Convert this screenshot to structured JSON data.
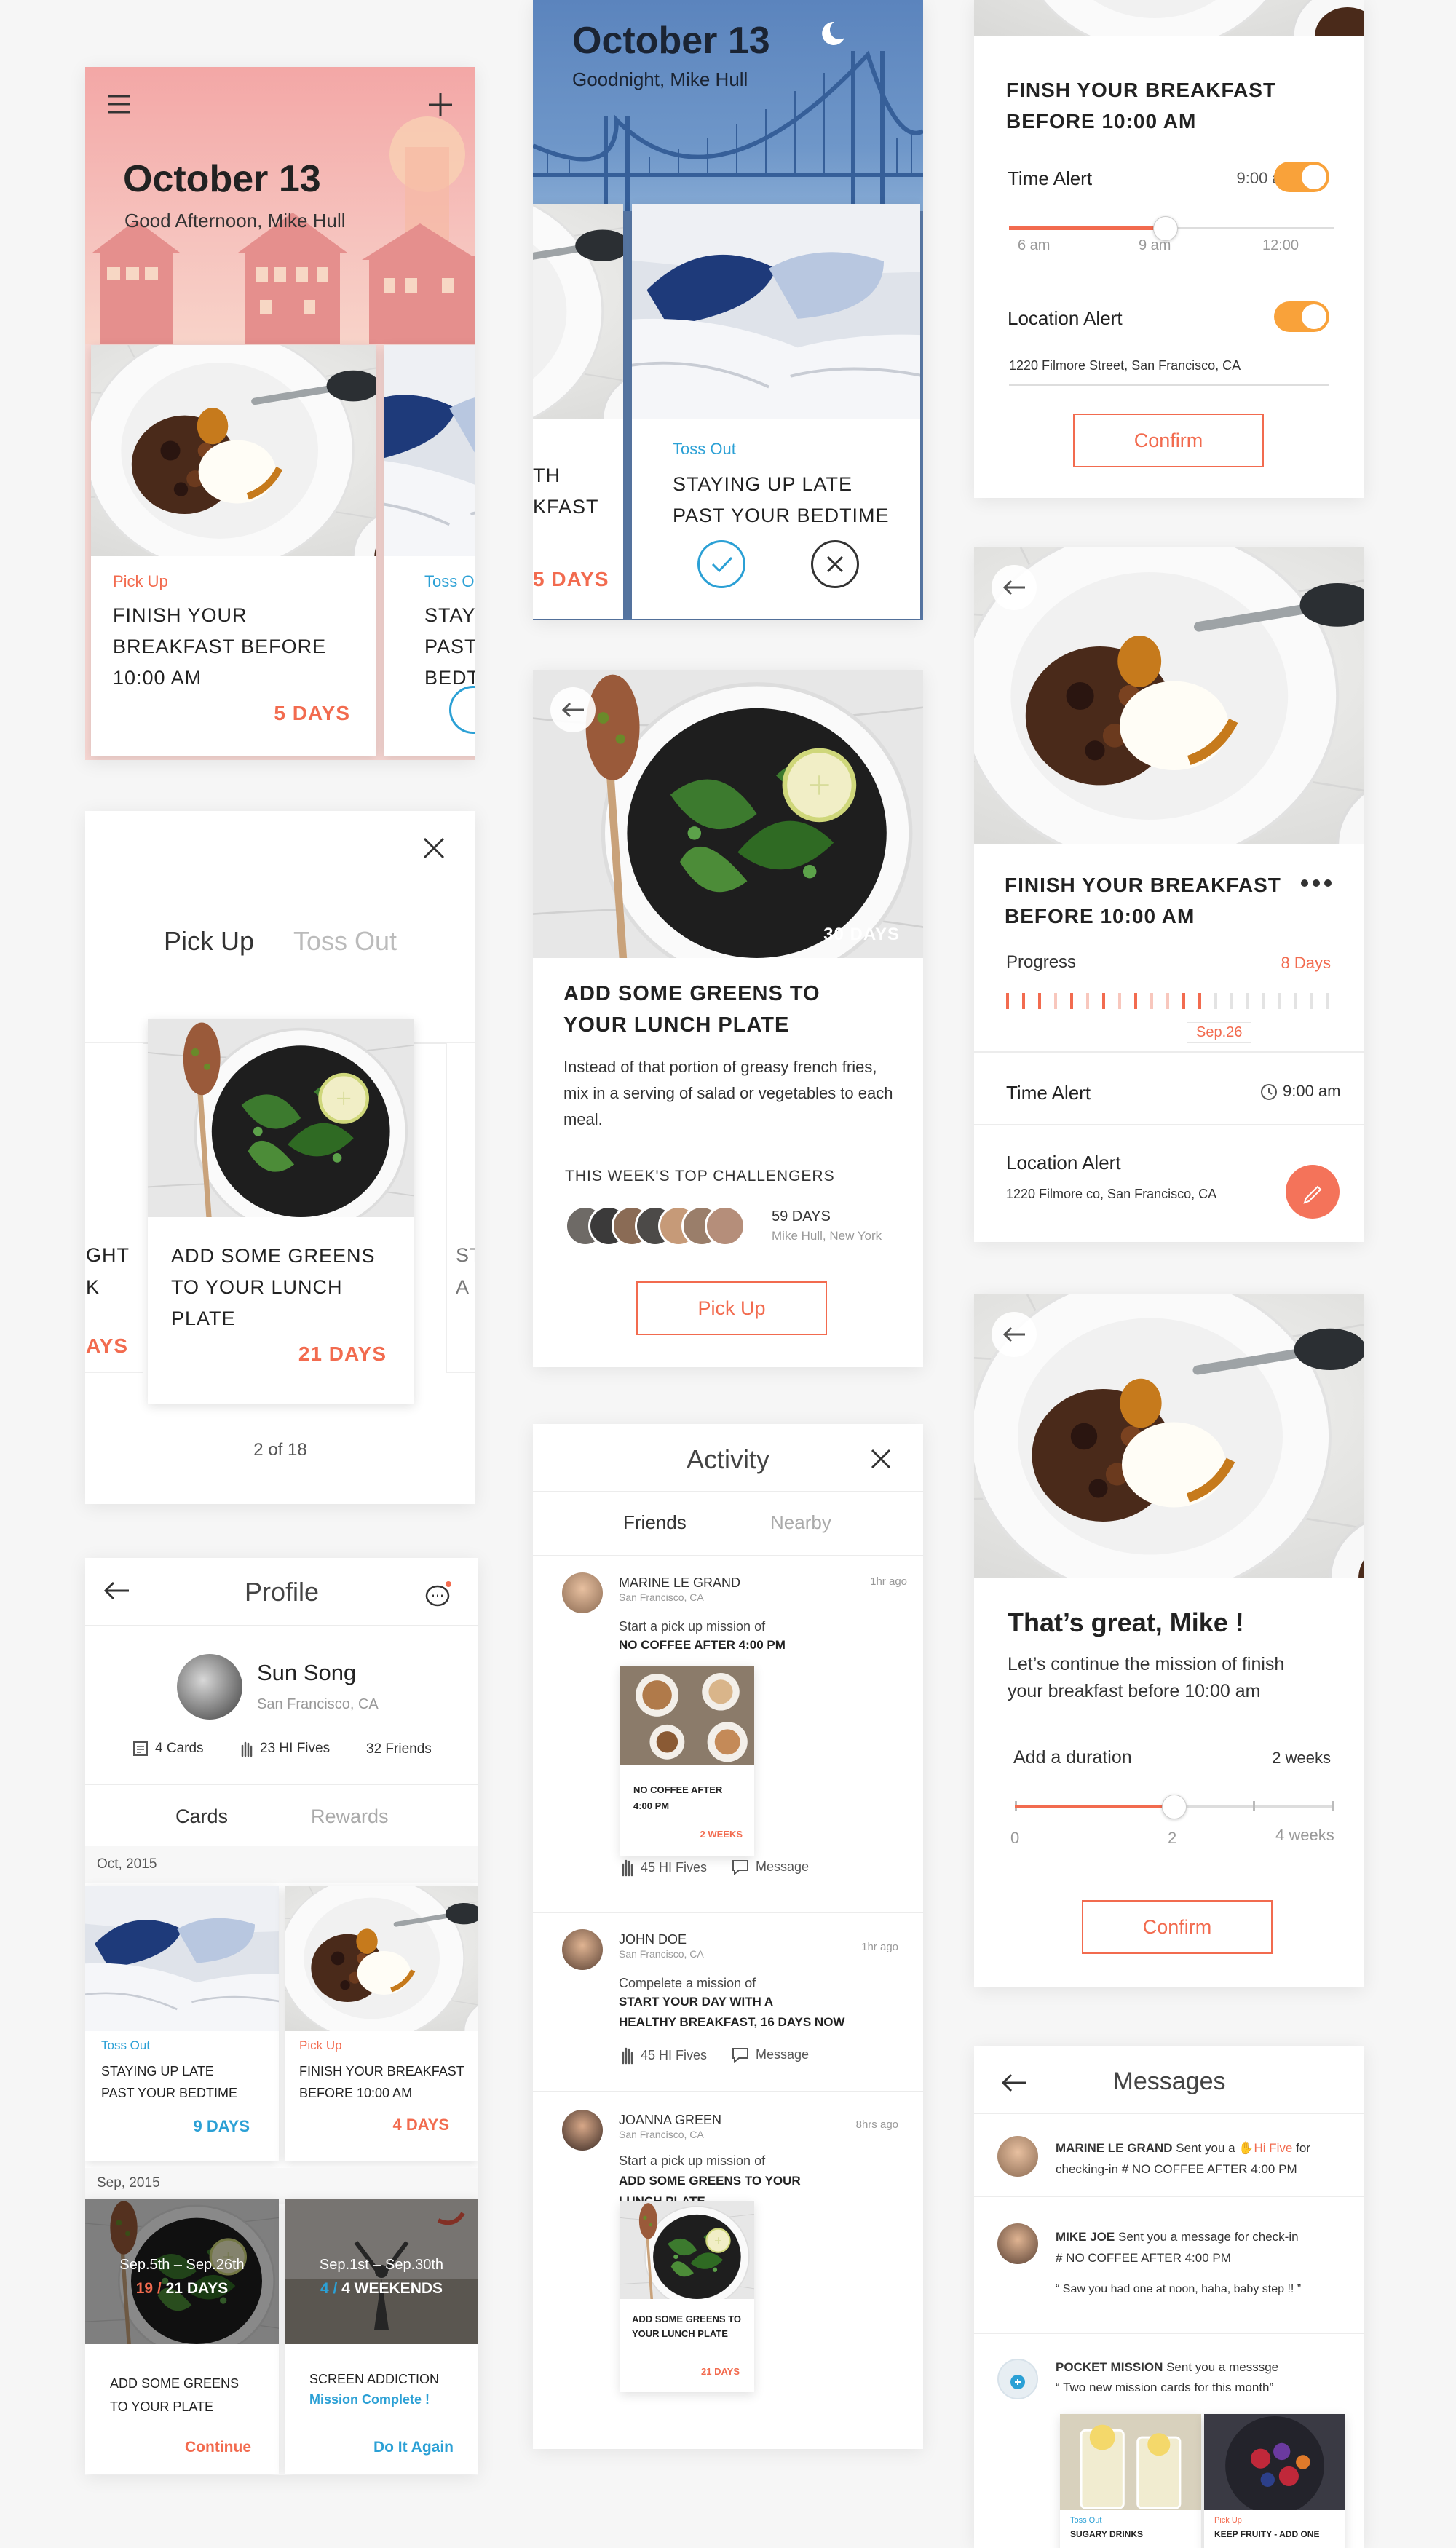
{
  "home_day": {
    "date": "October 13",
    "greeting": "Good Afternoon, Mike Hull",
    "card1": {
      "tag": "Pick Up",
      "title": "FINISH YOUR BREAKFAST BEFORE 10:00 AM",
      "days": "5 DAYS"
    },
    "card2": {
      "tag": "Toss Out",
      "title": "STAYING UP LATE PAST YOUR BEDTIME"
    }
  },
  "home_night": {
    "date": "October 13",
    "greeting": "Goodnight, Mike Hull",
    "left_card": {
      "title_l1": "TH",
      "title_l2": "KFAST",
      "days": "5 DAYS"
    },
    "card": {
      "tag": "Toss Out",
      "title": "STAYING UP LATE PAST YOUR BEDTIME"
    }
  },
  "alert_settings": {
    "title": "FINSH YOUR BREAKFAST BEFORE 10:00 AM",
    "time_alert_label": "Time Alert",
    "time_alert_value": "9:00 am",
    "ticks": [
      "6 am",
      "9 am",
      "12:00"
    ],
    "slider_value": 0.48,
    "location_alert_label": "Location Alert",
    "address": "1220 Filmore Street, San Francisco, CA",
    "confirm": "Confirm"
  },
  "picker": {
    "tab_active": "Pick Up",
    "tab_inactive": "Toss Out",
    "card": {
      "title": "ADD SOME GREENS TO YOUR lUNCH PLATE",
      "days": "21 DAYS"
    },
    "left_peek": {
      "l1": "GHT",
      "l2": "K",
      "days": "AYS"
    },
    "right_peek": {
      "l1": "STA",
      "l2": "A FR"
    },
    "pager": "2 of 18"
  },
  "detail": {
    "days_badge": "30 DAYS",
    "title": "ADD SOME GREENS TO YOUR LUNCH PLATE",
    "description": "Instead of that portion of greasy french fries, mix in a serving of salad or vegetables to each meal.",
    "challengers_label": "THIS WEEK'S TOP CHALLENGERS",
    "leader_days": "59 DAYS",
    "leader_info": "Mike Hull, New York",
    "pick_up": "Pick Up"
  },
  "progress": {
    "title": "FINISH YOUR BREAKFAST BEFORE 10:00 AM",
    "progress_label": "Progress",
    "days": "8 Days",
    "date_tip": "Sep.26",
    "time_alert_label": "Time Alert",
    "time_alert_value": "9:00 am",
    "location_label": "Location Alert",
    "address": "1220 Filmore co, San Francisco, CA"
  },
  "great": {
    "title": "That’s great, Mike !",
    "text": "Let’s continue the mission of finish your breakfast before 10:00 am",
    "duration_label": "Add a duration",
    "duration_value": "2 weeks",
    "ticks": [
      "0",
      "2",
      "4 weeks"
    ],
    "slider_value": 0.5,
    "confirm": "Confirm"
  },
  "profile": {
    "title": "Profile",
    "name": "Sun Song",
    "location": "San Francisco, CA",
    "stats": [
      "4 Cards",
      "23 HI Fives",
      "32 Friends"
    ],
    "tab_active": "Cards",
    "tab_inactive": "Rewards",
    "month1": "Oct, 2015",
    "month2": "Sep, 2015",
    "cards": [
      {
        "tag": "Toss Out",
        "title": "STAYING UP LATE PAST YOUR BEDTIME",
        "days": "9 DAYS"
      },
      {
        "tag": "Pick Up",
        "title": "FINISH YOUR BREAKFAST BEFORE 10:00 AM",
        "days": "4 DAYS"
      },
      {
        "range": "Sep.5th – Sep.26th",
        "done": "19",
        "total": "21 DAYS",
        "title": "ADD SOME GREENS TO YOUR PLATE",
        "action": "Continue"
      },
      {
        "range": "Sep.1st – Sep.30th",
        "done": "4",
        "total": "4 WEEKENDS",
        "title": "SCREEN ADDICTION",
        "status": "Mission Complete !",
        "action": "Do It Again"
      }
    ]
  },
  "activity": {
    "title": "Activity",
    "tab_active": "Friends",
    "tab_inactive": "Nearby",
    "items": [
      {
        "name": "MARINE LE GRAND",
        "loc": "San Francisco, CA",
        "time": "1hr ago",
        "line1": "Start a pick up mission of",
        "line2": "NO COFFEE AFTER 4:00 PM",
        "card_title": "NO COFFEE AFTER 4:00 PM",
        "card_days": "2 WEEKS",
        "hifive": "45 HI Fives",
        "message": "Message"
      },
      {
        "name": "JOHN DOE",
        "loc": "San Francisco, CA",
        "time": "1hr ago",
        "line1": "Compelete a mission of",
        "line2": "START YOUR DAY WITH A",
        "line3": "HEALTHY BREAKFAST, 16 DAYS NOW",
        "hifive": "45 HI Fives",
        "message": "Message"
      },
      {
        "name": "JOANNA GREEN",
        "loc": "San Francisco, CA",
        "time": "8hrs ago",
        "line1": "Start a pick up mission of",
        "line2": "ADD SOME GREENS TO YOUR",
        "line3": "LUNCH PLATE",
        "card_title": "ADD SOME GREENS TO YOUR LUNCH PLATE",
        "card_days": "21 DAYS"
      }
    ]
  },
  "messages": {
    "title": "Messages",
    "items": [
      {
        "name": "MARINE LE GRAND",
        "pre": "Sent you a",
        "hi": "Hi Five",
        "post": "for",
        "line2": "checking-in # NO COFFEE AFTER 4:00 PM"
      },
      {
        "name": "MIKE JOE",
        "pre": "Sent you a message for check-in",
        "line2": "# NO COFFEE AFTER 4:00 PM",
        "quote": "“ Saw you had one at noon, haha, baby step !! ”"
      },
      {
        "name": "POCKET MISSION",
        "pre": "Sent you a messsge",
        "quote": "“ Two new mission cards for this month”",
        "cards": [
          {
            "tag": "Toss Out",
            "title": "SUGARY DRINKS"
          },
          {
            "tag": "Pick Up",
            "title": "KEEP FRUITY - ADD ONE"
          }
        ]
      }
    ]
  },
  "colors": {
    "accent": "#f26b4f",
    "blue": "#2ba0d5",
    "toggle": "#f9a23a"
  }
}
